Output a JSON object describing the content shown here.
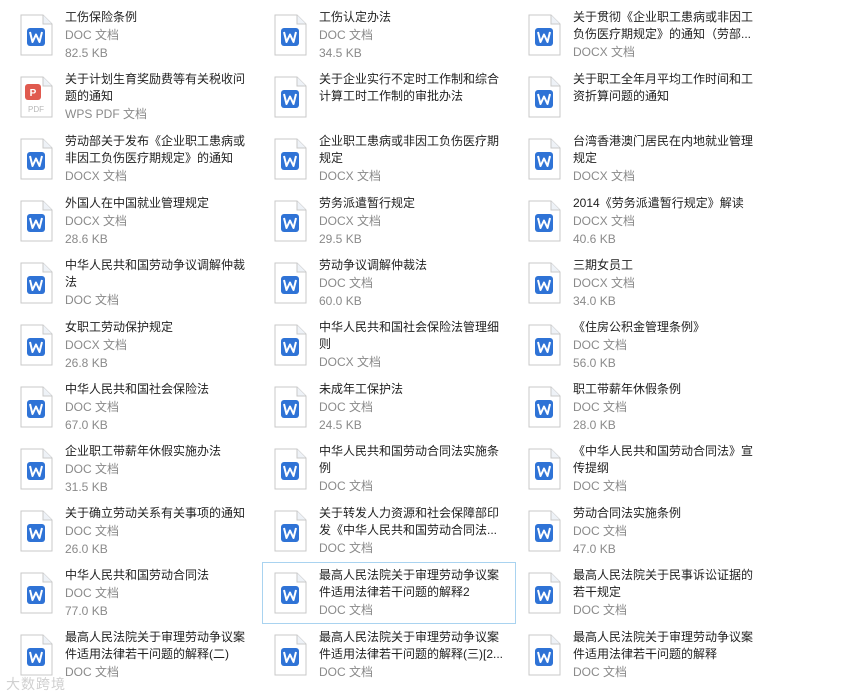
{
  "colors": {
    "word_blue": "#2f73d6",
    "pdf_red": "#e05a4f",
    "select_border": "#a9d3f0"
  },
  "files": [
    {
      "name": "工伤保险条例",
      "type": "DOC 文档",
      "size": "82.5 KB",
      "icon": "word-icon"
    },
    {
      "name": "工伤认定办法",
      "type": "DOC 文档",
      "size": "34.5 KB",
      "icon": "word-icon"
    },
    {
      "name": "关于贯彻《企业职工患病或非因工负伤医疗期规定》的通知（劳部...",
      "type": "DOCX 文档",
      "size": "",
      "icon": "word-icon"
    },
    {
      "name": "关于计划生育奖励费等有关税收问题的通知",
      "type": "WPS PDF 文档",
      "size": "",
      "icon": "pdf-icon"
    },
    {
      "name": "关于企业实行不定时工作制和综合计算工时工作制的审批办法",
      "type": "",
      "size": "",
      "icon": "word-icon"
    },
    {
      "name": "关于职工全年月平均工作时间和工资折算问题的通知",
      "type": "",
      "size": "",
      "icon": "word-icon"
    },
    {
      "name": "劳动部关于发布《企业职工患病或非因工负伤医疗期规定》的通知",
      "type": "DOCX 文档",
      "size": "",
      "icon": "word-icon"
    },
    {
      "name": "企业职工患病或非因工负伤医疗期规定",
      "type": "DOCX 文档",
      "size": "",
      "icon": "word-icon"
    },
    {
      "name": "台湾香港澳门居民在内地就业管理规定",
      "type": "DOCX 文档",
      "size": "",
      "icon": "word-icon"
    },
    {
      "name": "外国人在中国就业管理规定",
      "type": "DOCX 文档",
      "size": "28.6 KB",
      "icon": "word-icon"
    },
    {
      "name": "劳务派遣暂行规定",
      "type": "DOCX 文档",
      "size": "29.5 KB",
      "icon": "word-icon"
    },
    {
      "name": "2014《劳务派遣暂行规定》解读",
      "type": "DOCX 文档",
      "size": "40.6 KB",
      "icon": "word-icon"
    },
    {
      "name": "中华人民共和国劳动争议调解仲裁法",
      "type": "DOC 文档",
      "size": "",
      "icon": "word-icon"
    },
    {
      "name": "劳动争议调解仲裁法",
      "type": "DOC 文档",
      "size": "60.0 KB",
      "icon": "word-icon"
    },
    {
      "name": "三期女员工",
      "type": "DOCX 文档",
      "size": "34.0 KB",
      "icon": "word-icon"
    },
    {
      "name": "女职工劳动保护规定",
      "type": "DOCX 文档",
      "size": "26.8 KB",
      "icon": "word-icon"
    },
    {
      "name": "中华人民共和国社会保险法管理细则",
      "type": "DOCX 文档",
      "size": "",
      "icon": "word-icon"
    },
    {
      "name": "《住房公积金管理条例》",
      "type": "DOC 文档",
      "size": "56.0 KB",
      "icon": "word-icon"
    },
    {
      "name": "中华人民共和国社会保险法",
      "type": "DOC 文档",
      "size": "67.0 KB",
      "icon": "word-icon"
    },
    {
      "name": "未成年工保护法",
      "type": "DOC 文档",
      "size": "24.5 KB",
      "icon": "word-icon"
    },
    {
      "name": "职工带薪年休假条例",
      "type": "DOC 文档",
      "size": "28.0 KB",
      "icon": "word-icon"
    },
    {
      "name": "企业职工带薪年休假实施办法",
      "type": "DOC 文档",
      "size": "31.5 KB",
      "icon": "word-icon"
    },
    {
      "name": "中华人民共和国劳动合同法实施条例",
      "type": "DOC 文档",
      "size": "",
      "icon": "word-icon"
    },
    {
      "name": "《中华人民共和国劳动合同法》宣传提纲",
      "type": "DOC 文档",
      "size": "",
      "icon": "word-icon"
    },
    {
      "name": "关于确立劳动关系有关事项的通知",
      "type": "DOC 文档",
      "size": "26.0 KB",
      "icon": "word-icon"
    },
    {
      "name": "关于转发人力资源和社会保障部印发《中华人民共和国劳动合同法...",
      "type": "DOC 文档",
      "size": "",
      "icon": "word-icon"
    },
    {
      "name": "劳动合同法实施条例",
      "type": "DOC 文档",
      "size": "47.0 KB",
      "icon": "word-icon"
    },
    {
      "name": "中华人民共和国劳动合同法",
      "type": "DOC 文档",
      "size": "77.0 KB",
      "icon": "word-icon"
    },
    {
      "name": "最高人民法院关于审理劳动争议案件适用法律若干问题的解释2",
      "type": "DOC 文档",
      "size": "",
      "icon": "word-icon",
      "selected": true
    },
    {
      "name": "最高人民法院关于民事诉讼证据的若干规定",
      "type": "DOC 文档",
      "size": "",
      "icon": "word-icon"
    },
    {
      "name": "最高人民法院关于审理劳动争议案件适用法律若干问题的解释(二)",
      "type": "DOC 文档",
      "size": "",
      "icon": "word-icon"
    },
    {
      "name": "最高人民法院关于审理劳动争议案件适用法律若干问题的解释(三)[2...",
      "type": "DOC 文档",
      "size": "",
      "icon": "word-icon"
    },
    {
      "name": "最高人民法院关于审理劳动争议案件适用法律若干问题的解释",
      "type": "DOC 文档",
      "size": "",
      "icon": "word-icon"
    }
  ],
  "watermark": "大数跨境"
}
